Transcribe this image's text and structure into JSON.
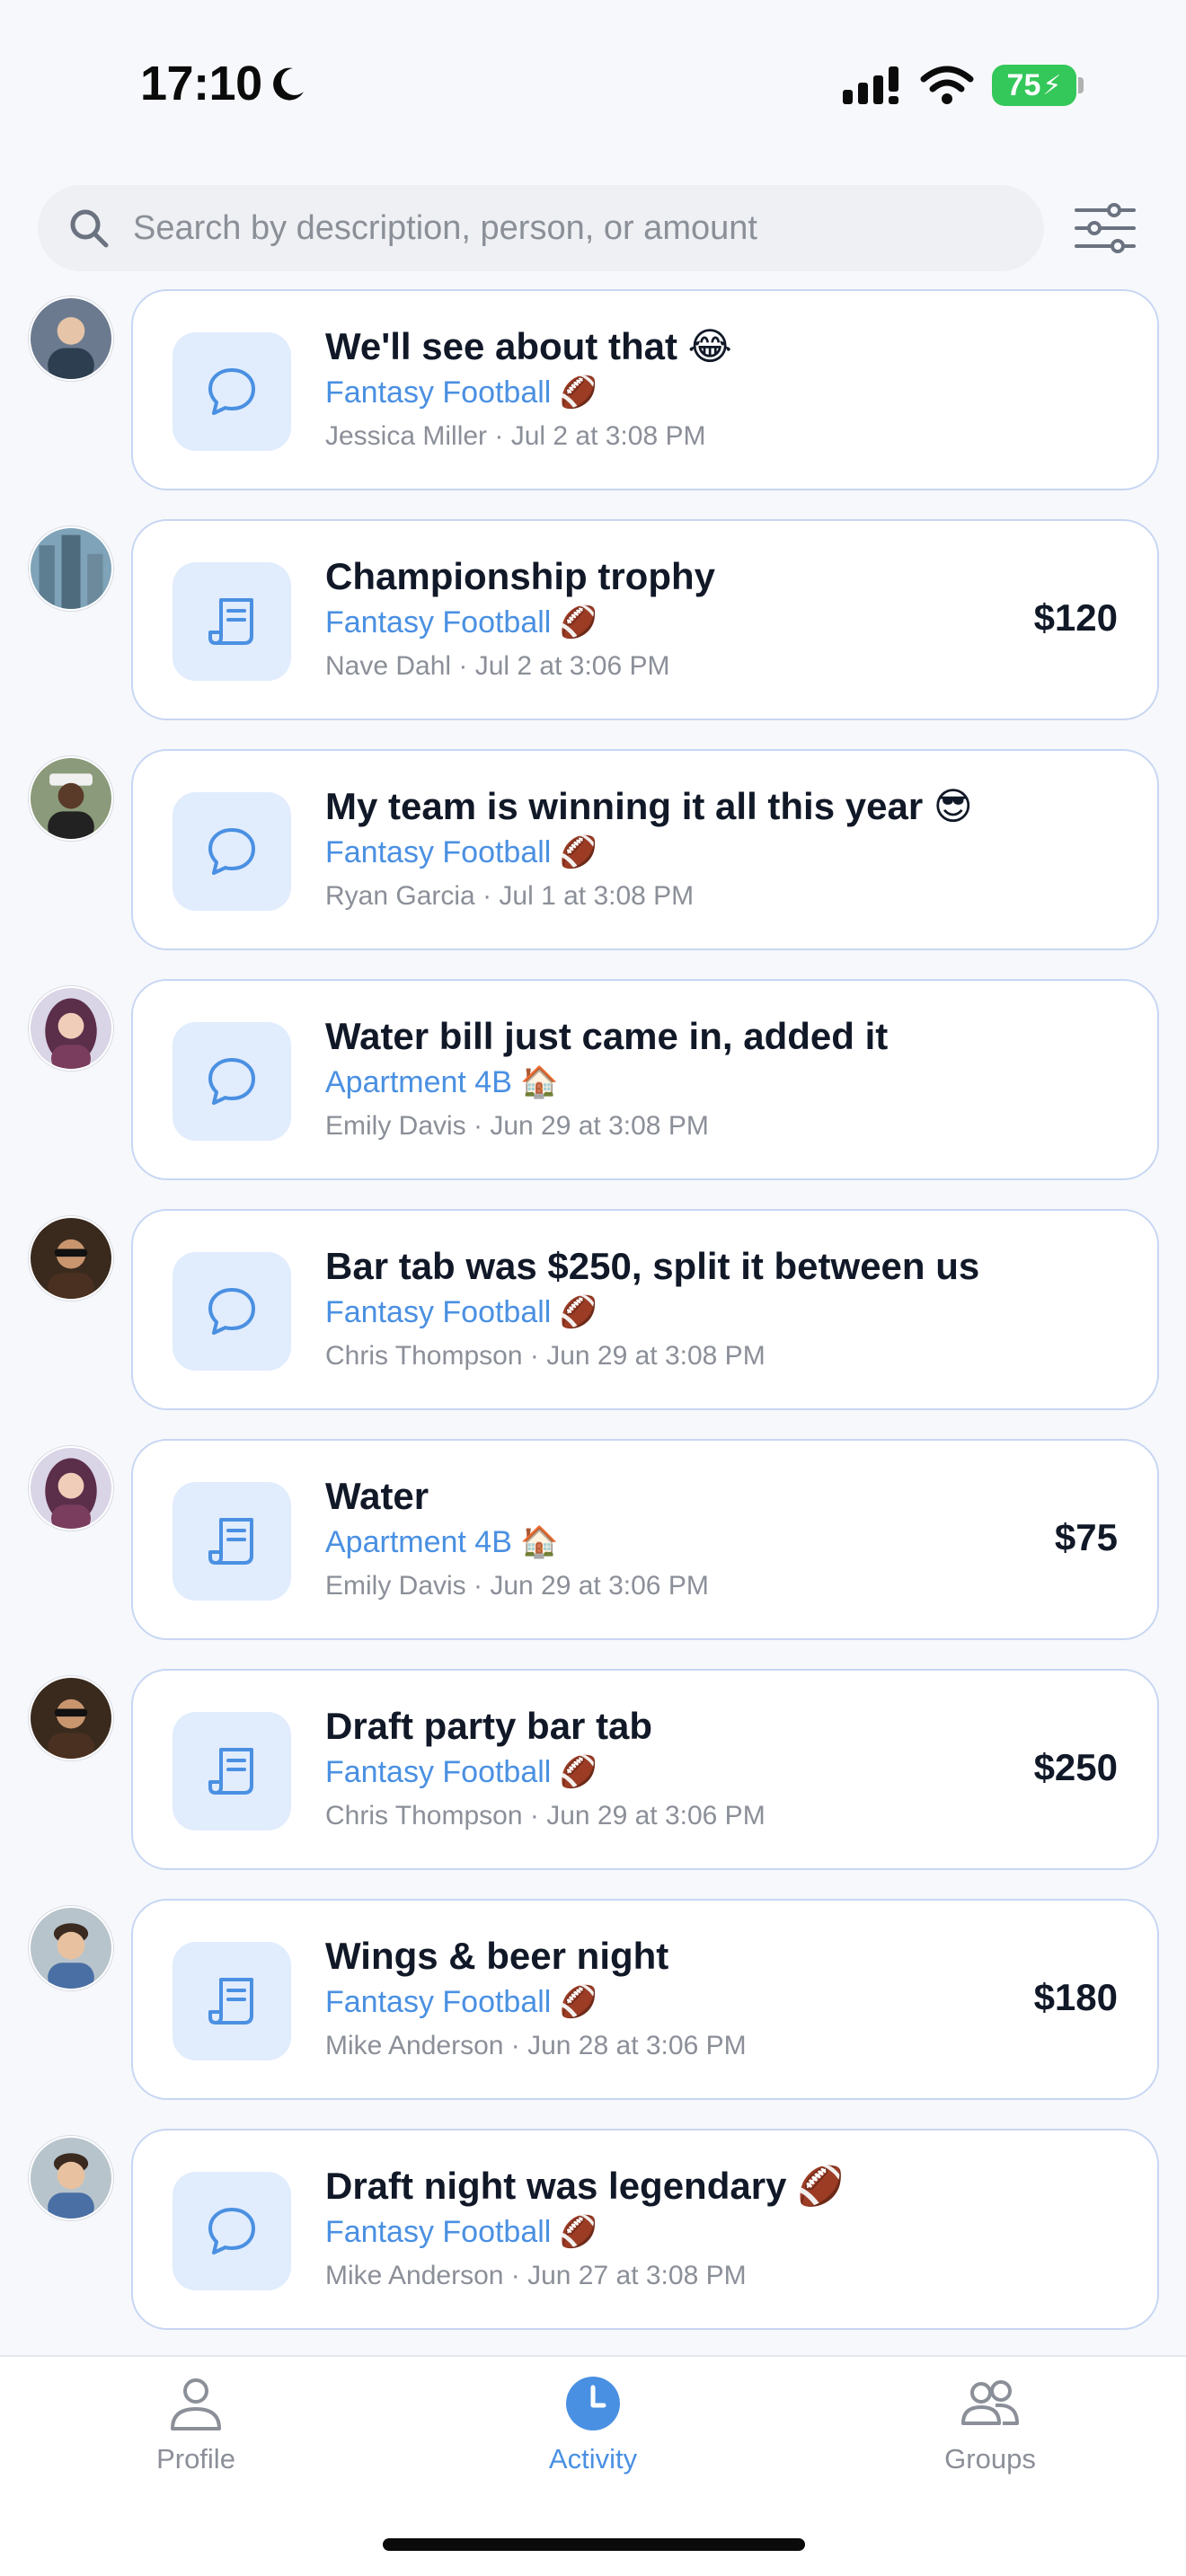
{
  "status_bar": {
    "time": "17:10",
    "battery": "75"
  },
  "search": {
    "placeholder": "Search by description, person, or amount"
  },
  "feed": [
    {
      "type": "comment",
      "title": "We'll see about that 😂",
      "group": "Fantasy Football 🏈",
      "meta": "Jessica Miller · Jul 2 at 3:08 PM",
      "amount": ""
    },
    {
      "type": "expense",
      "title": "Championship trophy",
      "group": "Fantasy Football 🏈",
      "meta": "Nave Dahl · Jul 2 at 3:06 PM",
      "amount": "$120"
    },
    {
      "type": "comment",
      "title": "My team is winning it all this year 😎",
      "group": "Fantasy Football 🏈",
      "meta": "Ryan Garcia · Jul 1 at 3:08 PM",
      "amount": ""
    },
    {
      "type": "comment",
      "title": "Water bill just came in, added it",
      "group": "Apartment 4B 🏠",
      "meta": "Emily Davis · Jun 29 at 3:08 PM",
      "amount": ""
    },
    {
      "type": "comment",
      "title": "Bar tab was $250, split it between us",
      "group": "Fantasy Football 🏈",
      "meta": "Chris Thompson · Jun 29 at 3:08 PM",
      "amount": ""
    },
    {
      "type": "expense",
      "title": "Water",
      "group": "Apartment 4B 🏠",
      "meta": "Emily Davis · Jun 29 at 3:06 PM",
      "amount": "$75"
    },
    {
      "type": "expense",
      "title": "Draft party bar tab",
      "group": "Fantasy Football 🏈",
      "meta": "Chris Thompson · Jun 29 at 3:06 PM",
      "amount": "$250"
    },
    {
      "type": "expense",
      "title": "Wings & beer night",
      "group": "Fantasy Football 🏈",
      "meta": "Mike Anderson · Jun 28 at 3:06 PM",
      "amount": "$180"
    },
    {
      "type": "comment",
      "title": "Draft night was legendary 🏈",
      "group": "Fantasy Football 🏈",
      "meta": "Mike Anderson · Jun 27 at 3:08 PM",
      "amount": ""
    }
  ],
  "tabs": [
    {
      "label": "Profile",
      "icon": "person-icon",
      "active": false
    },
    {
      "label": "Activity",
      "icon": "clock-icon",
      "active": true
    },
    {
      "label": "Groups",
      "icon": "people-icon",
      "active": false
    }
  ],
  "colors": {
    "accent": "#4a90e2",
    "card_border": "#c7d6f3",
    "icon_bg": "#e1ecfd",
    "battery": "#34c759"
  }
}
